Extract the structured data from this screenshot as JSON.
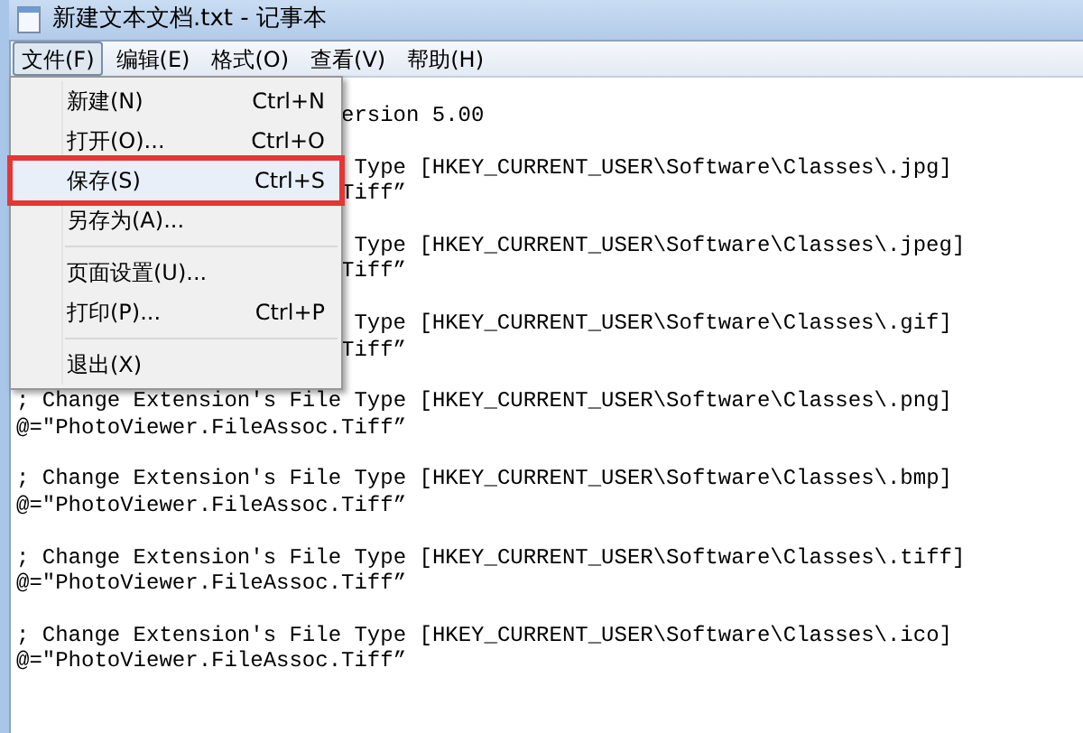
{
  "window": {
    "title": "新建文本文档.txt - 记事本"
  },
  "menu_bar": [
    {
      "label": "文件(F)",
      "selected": true
    },
    {
      "label": "编辑(E)",
      "selected": false
    },
    {
      "label": "格式(O)",
      "selected": false
    },
    {
      "label": "查看(V)",
      "selected": false
    },
    {
      "label": "帮助(H)",
      "selected": false
    }
  ],
  "file_menu": [
    {
      "kind": "item",
      "label": "新建(N)",
      "shortcut": "Ctrl+N",
      "selected": false
    },
    {
      "kind": "item",
      "label": "打开(O)...",
      "shortcut": "Ctrl+O",
      "selected": false
    },
    {
      "kind": "item",
      "label": "保存(S)",
      "shortcut": "Ctrl+S",
      "selected": true
    },
    {
      "kind": "item",
      "label": "另存为(A)...",
      "selected": false
    },
    {
      "kind": "separator"
    },
    {
      "kind": "item",
      "label": "页面设置(U)...",
      "selected": false
    },
    {
      "kind": "item",
      "label": "打印(P)...",
      "shortcut": "Ctrl+P",
      "selected": false
    },
    {
      "kind": "separator"
    },
    {
      "kind": "item",
      "label": "退出(X)",
      "selected": false
    }
  ],
  "editor_lines_beside_menu": [
    {
      "kind": "text",
      "text": "ersion 5.00"
    },
    {
      "kind": "blank"
    },
    {
      "kind": "text",
      "text": " Type [HKEY_CURRENT_USER\\Software\\Classes\\.jpg]"
    },
    {
      "kind": "text",
      "text": "Tiff”"
    },
    {
      "kind": "blank"
    },
    {
      "kind": "text",
      "text": " Type [HKEY_CURRENT_USER\\Software\\Classes\\.jpeg]"
    },
    {
      "kind": "text",
      "text": "Tiff”"
    },
    {
      "kind": "blank"
    },
    {
      "kind": "text",
      "text": " Type [HKEY_CURRENT_USER\\Software\\Classes\\.gif]"
    },
    {
      "kind": "text",
      "text": "Tiff”"
    },
    {
      "kind": "blank"
    }
  ],
  "editor_lines": [
    {
      "kind": "text",
      "text": "; Change Extension's File Type [HKEY_CURRENT_USER\\Software\\Classes\\.png]"
    },
    {
      "kind": "text",
      "text": "@=\"PhotoViewer.FileAssoc.Tiff”"
    },
    {
      "kind": "blank"
    },
    {
      "kind": "text",
      "text": "; Change Extension's File Type [HKEY_CURRENT_USER\\Software\\Classes\\.bmp]"
    },
    {
      "kind": "text",
      "text": "@=\"PhotoViewer.FileAssoc.Tiff”"
    },
    {
      "kind": "blank"
    },
    {
      "kind": "text",
      "text": "; Change Extension's File Type [HKEY_CURRENT_USER\\Software\\Classes\\.tiff]"
    },
    {
      "kind": "text",
      "text": "@=\"PhotoViewer.FileAssoc.Tiff”"
    },
    {
      "kind": "blank"
    },
    {
      "kind": "text",
      "text": "; Change Extension's File Type [HKEY_CURRENT_USER\\Software\\Classes\\.ico]"
    },
    {
      "kind": "text",
      "text": "@=\"PhotoViewer.FileAssoc.Tiff”"
    }
  ]
}
